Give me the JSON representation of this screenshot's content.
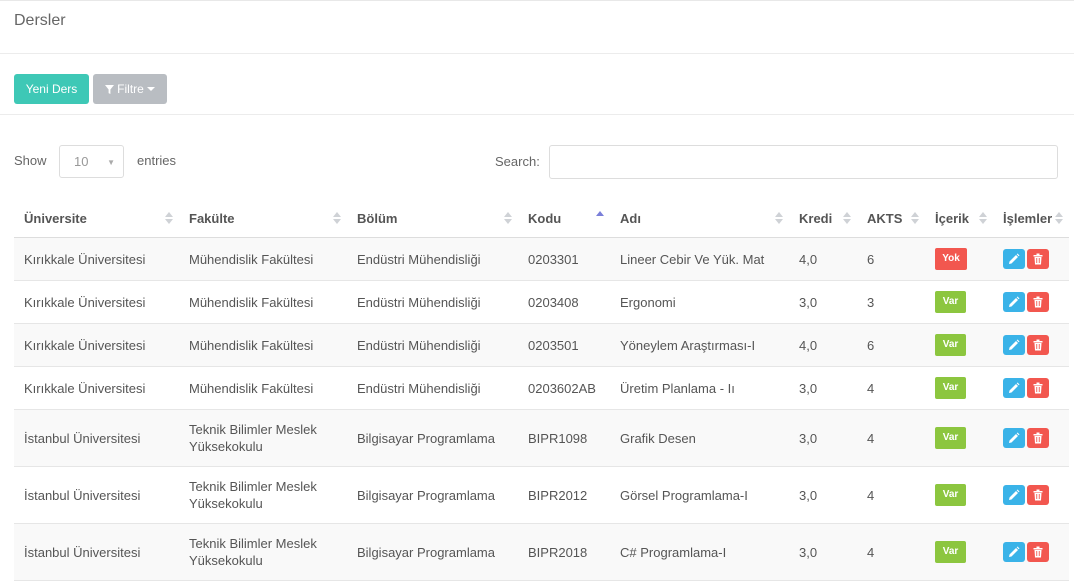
{
  "page": {
    "title": "Dersler"
  },
  "toolbar": {
    "new_label": "Yeni Ders",
    "filter_label": "Filtre"
  },
  "table_controls": {
    "show_label": "Show",
    "page_size": "10",
    "entries_label": "entries",
    "search_label": "Search:",
    "search_value": ""
  },
  "table": {
    "headers": [
      "Üniversite",
      "Fakülte",
      "Bölüm",
      "Kodu",
      "Adı",
      "Kredi",
      "AKTS",
      "İçerik",
      "İşlemler"
    ],
    "sorted_column": "Kodu",
    "sort_direction": "ascending",
    "rows": [
      {
        "universite": "Kırıkkale Üniversitesi",
        "fakulte": "Mühendislik Fakültesi",
        "bolum": "Endüstri Mühendisliği",
        "kodu": "0203301",
        "adi": "Lineer Cebir Ve Yük. Mat",
        "kredi": "4,0",
        "akts": "6",
        "icerik": "Yok"
      },
      {
        "universite": "Kırıkkale Üniversitesi",
        "fakulte": "Mühendislik Fakültesi",
        "bolum": "Endüstri Mühendisliği",
        "kodu": "0203408",
        "adi": "Ergonomi",
        "kredi": "3,0",
        "akts": "3",
        "icerik": "Var"
      },
      {
        "universite": "Kırıkkale Üniversitesi",
        "fakulte": "Mühendislik Fakültesi",
        "bolum": "Endüstri Mühendisliği",
        "kodu": "0203501",
        "adi": "Yöneylem Araştırması-I",
        "kredi": "4,0",
        "akts": "6",
        "icerik": "Var"
      },
      {
        "universite": "Kırıkkale Üniversitesi",
        "fakulte": "Mühendislik Fakültesi",
        "bolum": "Endüstri Mühendisliği",
        "kodu": "0203602AB",
        "adi": "Üretim Planlama - Iı",
        "kredi": "3,0",
        "akts": "4",
        "icerik": "Var"
      },
      {
        "universite": "İstanbul Üniversitesi",
        "fakulte": "Teknik Bilimler Meslek Yüksekokulu",
        "bolum": "Bilgisayar Programlama",
        "kodu": "BIPR1098",
        "adi": "Grafik Desen",
        "kredi": "3,0",
        "akts": "4",
        "icerik": "Var"
      },
      {
        "universite": "İstanbul Üniversitesi",
        "fakulte": "Teknik Bilimler Meslek Yüksekokulu",
        "bolum": "Bilgisayar Programlama",
        "kodu": "BIPR2012",
        "adi": "Görsel Programlama-I",
        "kredi": "3,0",
        "akts": "4",
        "icerik": "Var"
      },
      {
        "universite": "İstanbul Üniversitesi",
        "fakulte": "Teknik Bilimler Meslek Yüksekokulu",
        "bolum": "Bilgisayar Programlama",
        "kodu": "BIPR2018",
        "adi": "C# Programlama-I",
        "kredi": "3,0",
        "akts": "4",
        "icerik": "Var"
      }
    ]
  },
  "colors": {
    "primary": "#3ec8b6",
    "filter": "#b9bdc2",
    "badge_yok": "#f2574f",
    "badge_var": "#8cc63f",
    "edit": "#3ab3e8",
    "delete": "#f2574f"
  },
  "icons": {
    "filter": "filter-icon",
    "edit": "pencil-icon",
    "delete": "trash-icon",
    "sort": "sort-arrows-icon"
  }
}
